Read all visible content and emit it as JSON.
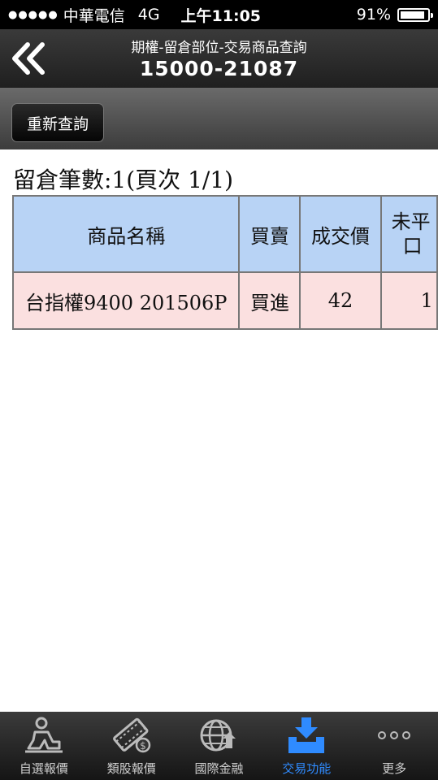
{
  "status_bar": {
    "signal": "●●●●●",
    "carrier": "中華電信",
    "network": "4G",
    "time": "上午11:05",
    "battery": "91%",
    "battery_level": 0.91
  },
  "header": {
    "title": "期權-留倉部位-交易商品查詢",
    "account": "15000-21087"
  },
  "toolbar": {
    "refresh_label": "重新查詢"
  },
  "summary": {
    "text": "留倉筆數:1(頁次 1/1)"
  },
  "table": {
    "columns": [
      "商品名稱",
      "買賣",
      "成交價",
      "未平",
      "口"
    ],
    "rows": [
      {
        "product": "台指權9400 201506P",
        "side": "買進",
        "price": "42",
        "open": "1"
      }
    ]
  },
  "tabbar": {
    "items": [
      {
        "label": "自選報價",
        "icon": "person-sitting-icon"
      },
      {
        "label": "類股報價",
        "icon": "film-stocks-icon"
      },
      {
        "label": "國際金融",
        "icon": "globe-icon"
      },
      {
        "label": "交易功能",
        "icon": "download-tray-icon"
      },
      {
        "label": "更多",
        "icon": "more-dots-icon"
      }
    ],
    "active_color": "#2f8bff"
  }
}
